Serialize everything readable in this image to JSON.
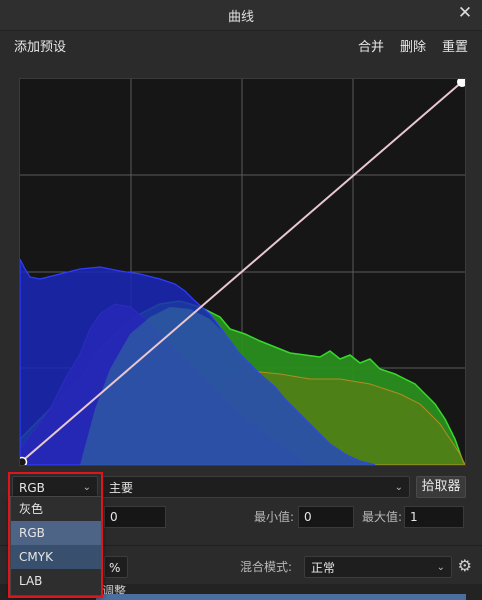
{
  "window": {
    "title": "曲线",
    "close_label": "✕"
  },
  "toolbar": {
    "add_preset": "添加预设",
    "merge": "合并",
    "delete": "删除",
    "reset": "重置"
  },
  "controls": {
    "color_space": "RGB",
    "channel": "主要",
    "picker": "拾取器",
    "min_label": "最小值:",
    "min_value": "0",
    "max_label": "最大值:",
    "max_value": "1",
    "left_value": "0",
    "blend_label": "混合模式:",
    "blend_value": "正常",
    "partial_left": "%",
    "bottom_text": "线调整"
  },
  "dropdown": {
    "options": [
      "灰色",
      "RGB",
      "CMYK",
      "LAB"
    ],
    "selected": "RGB"
  },
  "colors": {
    "blue_hist": "#1a2ab5",
    "purple_hist": "#7a24b8",
    "green_hist": "#2aa020",
    "curve": "#e8c7cf",
    "highlight": "#e0141b"
  }
}
